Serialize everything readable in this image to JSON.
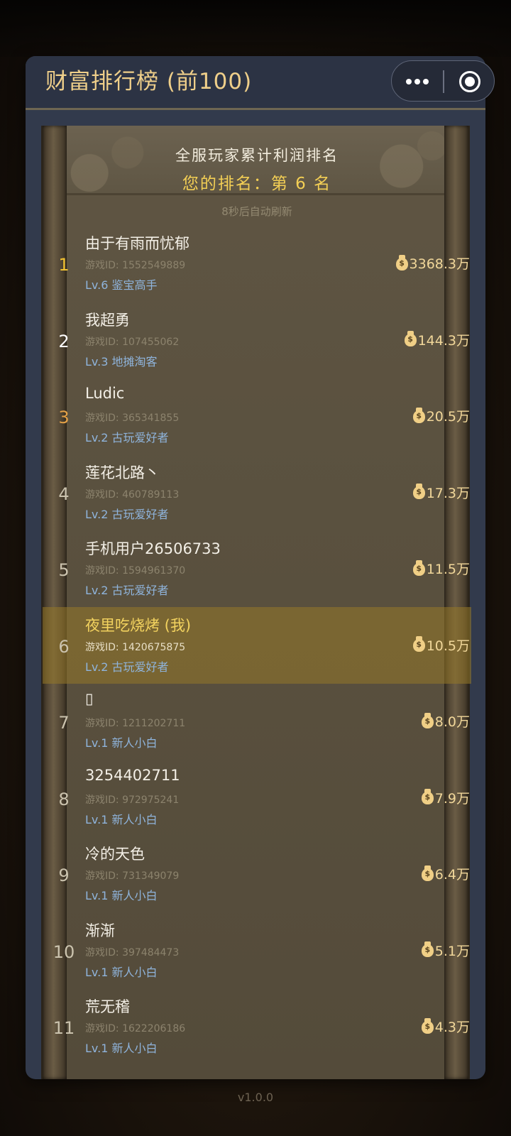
{
  "window": {
    "title": "财富排行榜 (前100)"
  },
  "list": {
    "title": "全服玩家累计利润排名",
    "my_rank_text": "您的排名：第 6 名",
    "refresh_text": "8秒后自动刷新",
    "currency_icon": "money-bag-icon",
    "colors": {
      "gold": "#f1c232",
      "silver": "#ffffff",
      "bronze": "#e4a147",
      "highlight": "#f3d35f"
    }
  },
  "rows": [
    {
      "rank": "1",
      "name": "由于有雨而忧郁",
      "player_id": "游戏ID: 1552549889",
      "level": "Lv.6 鉴宝高手",
      "wealth": "3368.3万"
    },
    {
      "rank": "2",
      "name": "我超勇",
      "player_id": "游戏ID: 107455062",
      "level": "Lv.3 地摊淘客",
      "wealth": "144.3万"
    },
    {
      "rank": "3",
      "name": "Ludic",
      "player_id": "游戏ID: 365341855",
      "level": "Lv.2 古玩爱好者",
      "wealth": "20.5万"
    },
    {
      "rank": "4",
      "name": "莲花北路丶",
      "player_id": "游戏ID: 460789113",
      "level": "Lv.2 古玩爱好者",
      "wealth": "17.3万"
    },
    {
      "rank": "5",
      "name": "手机用户26506733",
      "player_id": "游戏ID: 1594961370",
      "level": "Lv.2 古玩爱好者",
      "wealth": "11.5万"
    },
    {
      "rank": "6",
      "name": "夜里吃烧烤 (我)",
      "player_id": "游戏ID: 1420675875",
      "level": "Lv.2 古玩爱好者",
      "wealth": "10.5万"
    },
    {
      "rank": "7",
      "name": "▯",
      "player_id": "游戏ID: 1211202711",
      "level": "Lv.1 新人小白",
      "wealth": "8.0万"
    },
    {
      "rank": "8",
      "name": "3254402711",
      "player_id": "游戏ID: 972975241",
      "level": "Lv.1 新人小白",
      "wealth": "7.9万"
    },
    {
      "rank": "9",
      "name": "冷的天色",
      "player_id": "游戏ID: 731349079",
      "level": "Lv.1 新人小白",
      "wealth": "6.4万"
    },
    {
      "rank": "10",
      "name": "渐渐",
      "player_id": "游戏ID: 397484473",
      "level": "Lv.1 新人小白",
      "wealth": "5.1万"
    },
    {
      "rank": "11",
      "name": "荒无稽",
      "player_id": "游戏ID: 1622206186",
      "level": "Lv.1 新人小白",
      "wealth": "4.3万"
    }
  ],
  "footer": {
    "version": "v1.0.0"
  }
}
